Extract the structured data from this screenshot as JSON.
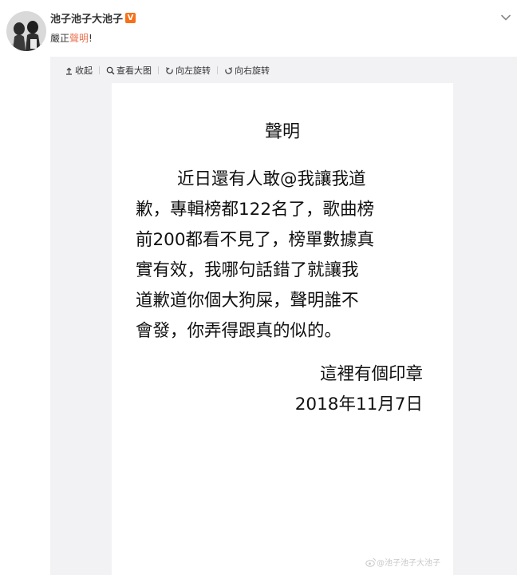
{
  "post": {
    "username": "池子池子大池子",
    "verified_badge": "V",
    "text_prefix": "嚴正",
    "text_highlight": "聲明",
    "text_suffix": "!",
    "menu_icon": "chevron-down-icon"
  },
  "toolbar": {
    "collapse_label": "收起",
    "view_large_label": "查看大图",
    "rotate_left_label": "向左旋转",
    "rotate_right_label": "向右旋转"
  },
  "document": {
    "title": "聲明",
    "body_lines": [
      "近日還有人敢@我讓我道",
      "歉，專輯榜都122名了，歌曲榜",
      "前200都看不見了，榜單數據真",
      "實有效，我哪句話錯了就讓我",
      "道歉道你個大狗屎，聲明誰不",
      "會發，你弄得跟真的似的。"
    ],
    "seal_line": "這裡有個印章",
    "date_line": "2018年11月7日"
  },
  "watermark": {
    "text": "@池子池子大池子",
    "icon": "weibo-icon"
  },
  "colors": {
    "highlight": "#eb7350",
    "badge": "#f6711a",
    "panel_bg": "#f2f2f5"
  }
}
